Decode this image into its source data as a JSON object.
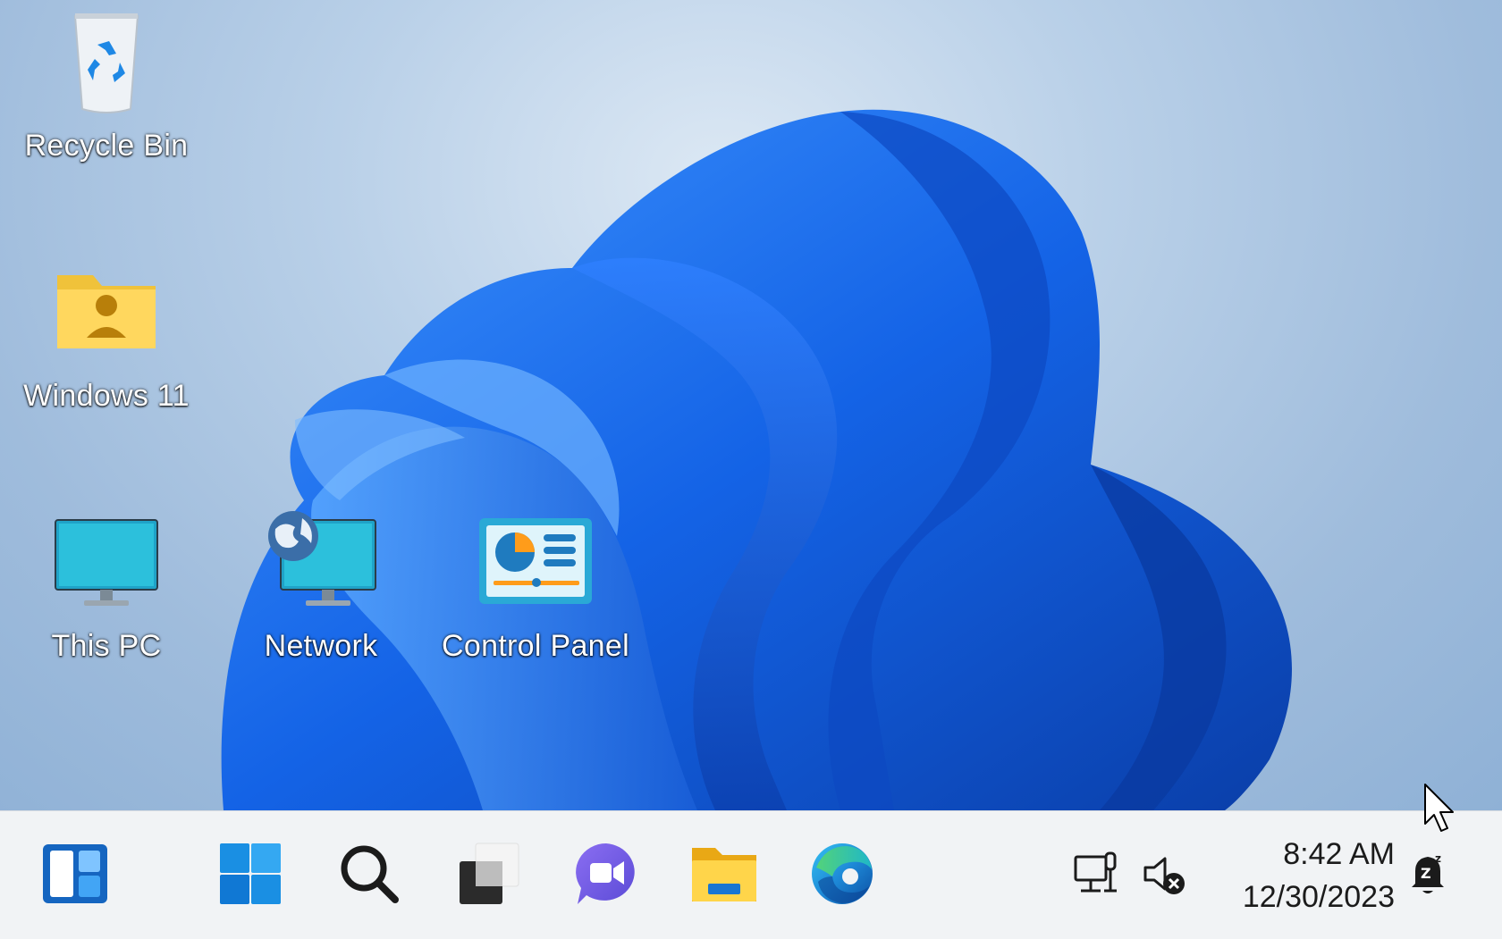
{
  "desktop": {
    "icons": [
      {
        "label": "Recycle Bin"
      },
      {
        "label": "Windows 11"
      },
      {
        "label": "This PC"
      },
      {
        "label": "Network"
      },
      {
        "label": "Control Panel"
      }
    ]
  },
  "taskbar": {
    "items": [
      {
        "icon": "widgets-icon"
      },
      {
        "icon": "start-icon"
      },
      {
        "icon": "search-icon"
      },
      {
        "icon": "task-view-icon"
      },
      {
        "icon": "teams-chat-icon"
      },
      {
        "icon": "file-explorer-icon"
      },
      {
        "icon": "edge-icon"
      }
    ],
    "tray": {
      "network_icon": "network-disconnected-icon",
      "volume_icon": "volume-muted-icon",
      "time": "8:42 AM",
      "date": "12/30/2023",
      "notification_icon": "notifications-snoozed-icon"
    }
  },
  "colors": {
    "accent": "#0067c0",
    "wallpaper_blue": "#1b6ff0",
    "taskbar_bg": "#f1f3f5"
  }
}
